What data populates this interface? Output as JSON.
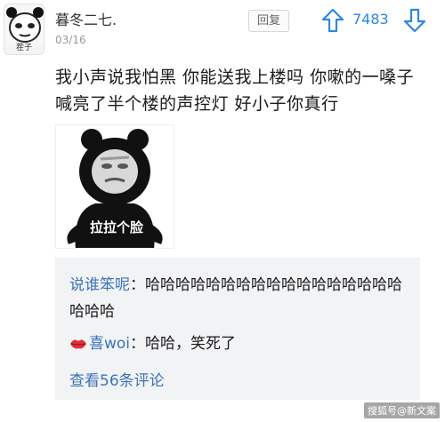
{
  "comment": {
    "username": "暮冬二七.",
    "date": "03/16",
    "reply_label": "回复",
    "vote_count": "7483",
    "avatar_caption": "茬子",
    "text": "我小声说我怕黑 你能送我上楼吗 你嗽的一嗓子喊亮了半个楼的声控灯 好小子你真行",
    "meme_caption": "拉拉个脸"
  },
  "replies": [
    {
      "user": "说谁笨呢",
      "separator": "：",
      "text": "哈哈哈哈哈哈哈哈哈哈哈哈哈哈哈哈哈哈哈哈"
    },
    {
      "user": "喜woi",
      "separator": "：",
      "text": "哈哈，笑死了",
      "icon": "lips-icon"
    }
  ],
  "view_more_label": "查看56条评论",
  "watermark": "搜狐号@新文案",
  "colors": {
    "vote": "#2e86de",
    "link": "#3b73b9",
    "reply_box_bg": "#f2f3f5"
  }
}
